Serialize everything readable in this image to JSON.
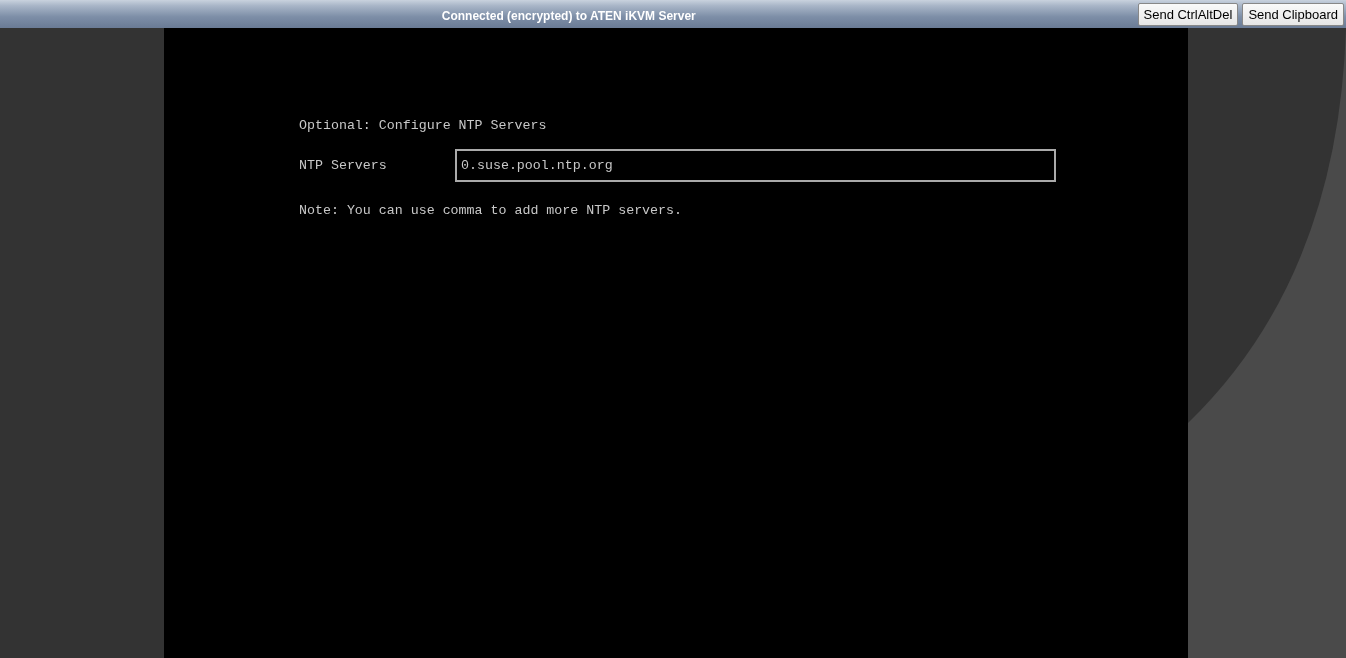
{
  "window": {
    "title": "Connected (encrypted) to ATEN iKVM Server"
  },
  "toolbar": {
    "buttons": [
      "Send CtrlAltDel",
      "Send Clipboard"
    ]
  },
  "console": {
    "heading": "Optional: Configure NTP Servers",
    "fields": [
      {
        "label": "NTP Servers",
        "value": "0.suse.pool.ntp.org"
      }
    ],
    "note": "Note: You can use comma to add more NTP servers."
  }
}
